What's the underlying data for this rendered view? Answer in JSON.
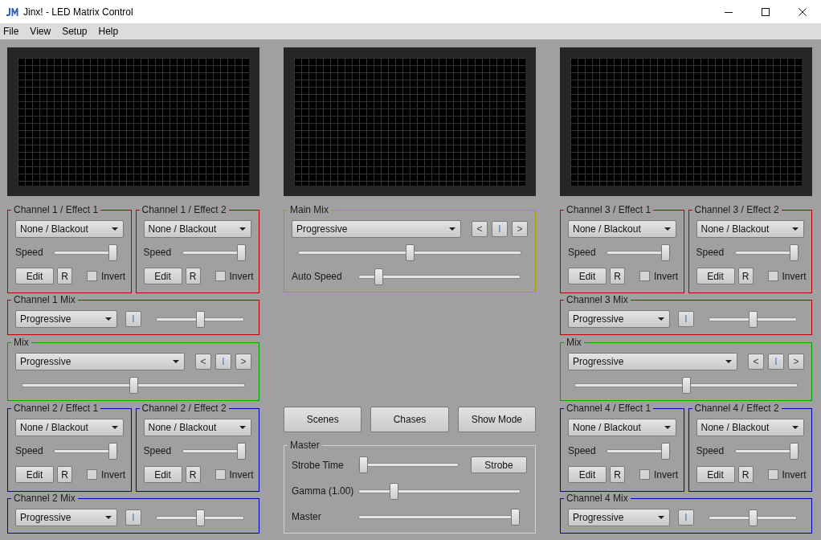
{
  "window": {
    "title": "Jinx! - LED Matrix Control"
  },
  "menu": [
    "File",
    "View",
    "Setup",
    "Help"
  ],
  "columns": [
    {
      "kind": "side",
      "sections": [
        {
          "kind": "effects",
          "groups": [
            {
              "title": "Channel 1 / Effect 1",
              "color": "#b80000",
              "effect": "None / Blackout",
              "speed": {
                "label": "Speed",
                "level": 1
              },
              "edit": "Edit",
              "reset": "R",
              "invert": {
                "label": "Invert",
                "checked": false
              }
            },
            {
              "title": "Channel 1 / Effect 2",
              "color": "#b80000",
              "effect": "None / Blackout",
              "speed": {
                "label": "Speed",
                "level": 1
              },
              "edit": "Edit",
              "reset": "R",
              "invert": {
                "label": "Invert",
                "checked": false
              }
            }
          ]
        },
        {
          "kind": "channel_mix",
          "title": "Channel 1 Mix",
          "color": "#b80000",
          "mode": "Progressive",
          "toggle": "I",
          "fader": {
            "level": 0.5
          }
        },
        {
          "kind": "mix",
          "title": "Mix",
          "color": "#00a000",
          "mode": "Progressive",
          "buttons": [
            {
              "kind": "plain",
              "label": "<"
            },
            {
              "kind": "accent",
              "label": "I"
            },
            {
              "kind": "plain",
              "label": ">"
            }
          ],
          "fader": {
            "level": 0.5
          }
        },
        {
          "kind": "effects",
          "groups": [
            {
              "title": "Channel 2 / Effect 1",
              "color": "#0000b4",
              "effect": "None / Blackout",
              "speed": {
                "label": "Speed",
                "level": 1
              },
              "edit": "Edit",
              "reset": "R",
              "invert": {
                "label": "Invert",
                "checked": false
              }
            },
            {
              "title": "Channel 2 / Effect 2",
              "color": "#0000b4",
              "effect": "None / Blackout",
              "speed": {
                "label": "Speed",
                "level": 1
              },
              "edit": "Edit",
              "reset": "R",
              "invert": {
                "label": "Invert",
                "checked": false
              }
            }
          ]
        },
        {
          "kind": "channel_mix",
          "title": "Channel 2 Mix",
          "color": "#0000b4",
          "mode": "Progressive",
          "toggle": "I",
          "fader": {
            "level": 0.5
          }
        }
      ]
    },
    {
      "kind": "center",
      "main_mix": {
        "title": "Main Mix",
        "mode": "Progressive",
        "buttons": [
          {
            "kind": "plain",
            "label": "<"
          },
          {
            "kind": "accent",
            "label": "I"
          },
          {
            "kind": "plain",
            "label": ">"
          }
        ],
        "fader": {
          "level": 0.5
        },
        "auto_speed": {
          "label": "Auto Speed",
          "level": 0.1
        }
      },
      "mode_buttons": [
        "Scenes",
        "Chases",
        "Show Mode"
      ],
      "master": {
        "title": "Master",
        "rows": [
          {
            "kind": "strobe",
            "label": "Strobe Time",
            "level": 0,
            "button": "Strobe"
          },
          {
            "kind": "slider",
            "label": "Gamma (1.00)",
            "level": 0.2
          },
          {
            "kind": "slider",
            "label": "Master",
            "level": 1
          }
        ]
      }
    },
    {
      "kind": "side",
      "sections": [
        {
          "kind": "effects",
          "groups": [
            {
              "title": "Channel 3 / Effect 1",
              "color": "#b80000",
              "effect": "None / Blackout",
              "speed": {
                "label": "Speed",
                "level": 1
              },
              "edit": "Edit",
              "reset": "R",
              "invert": {
                "label": "Invert",
                "checked": false
              }
            },
            {
              "title": "Channel 3 / Effect 2",
              "color": "#b80000",
              "effect": "None / Blackout",
              "speed": {
                "label": "Speed",
                "level": 1
              },
              "edit": "Edit",
              "reset": "R",
              "invert": {
                "label": "Invert",
                "checked": false
              }
            }
          ]
        },
        {
          "kind": "channel_mix",
          "title": "Channel 3 Mix",
          "color": "#b80000",
          "mode": "Progressive",
          "toggle": "I",
          "fader": {
            "level": 0.5
          }
        },
        {
          "kind": "mix",
          "title": "Mix",
          "color": "#00a000",
          "mode": "Progressive",
          "buttons": [
            {
              "kind": "plain",
              "label": "<"
            },
            {
              "kind": "accent",
              "label": "I"
            },
            {
              "kind": "plain",
              "label": ">"
            }
          ],
          "fader": {
            "level": 0.5
          }
        },
        {
          "kind": "effects",
          "groups": [
            {
              "title": "Channel 4 / Effect 1",
              "color": "#0000b4",
              "effect": "None / Blackout",
              "speed": {
                "label": "Speed",
                "level": 1
              },
              "edit": "Edit",
              "reset": "R",
              "invert": {
                "label": "Invert",
                "checked": false
              }
            },
            {
              "title": "Channel 4 / Effect 2",
              "color": "#0000b4",
              "effect": "None / Blackout",
              "speed": {
                "label": "Speed",
                "level": 1
              },
              "edit": "Edit",
              "reset": "R",
              "invert": {
                "label": "Invert",
                "checked": false
              }
            }
          ]
        },
        {
          "kind": "channel_mix",
          "title": "Channel 4 Mix",
          "color": "#0000b4",
          "mode": "Progressive",
          "toggle": "I",
          "fader": {
            "level": 0.5
          }
        }
      ]
    }
  ]
}
